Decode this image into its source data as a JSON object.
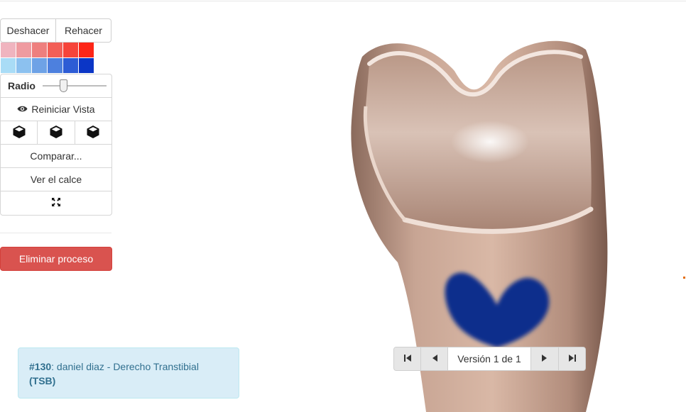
{
  "toolbar": {
    "undo_label": "Deshacer",
    "redo_label": "Rehacer"
  },
  "palette": {
    "red_row": [
      "#f0b4bf",
      "#ef9ba0",
      "#ee7f7e",
      "#f25f57",
      "#f6443a",
      "#fd2618"
    ],
    "blue_row": [
      "#a9dcf6",
      "#8cc1ef",
      "#6ea2e6",
      "#4d80de",
      "#2d5cd5",
      "#0b36c6"
    ]
  },
  "panel": {
    "radius_label": "Radio",
    "radius_value": 0.3,
    "reset_view_label": "Reiniciar Vista",
    "compare_label": "Comparar...",
    "fit_label": "Ver el calce"
  },
  "actions": {
    "delete_label": "Eliminar proceso"
  },
  "info": {
    "id": "#130",
    "text": ": daniel diaz - Derecho Transtibial",
    "code": "(TSB)"
  },
  "version_nav": {
    "label": "Versión 1 de 1"
  },
  "colors": {
    "danger": "#d9534f",
    "info_bg": "#d9edf7",
    "info_text": "#31708f",
    "marking": "#0a2f8c"
  },
  "icons": {
    "reset": "eye-icon",
    "views": [
      "cube-icon",
      "cube-icon",
      "cube-icon"
    ],
    "fullscreen": "expand-icon",
    "nav": [
      "first-icon",
      "prev-icon",
      "next-icon",
      "last-icon"
    ]
  }
}
